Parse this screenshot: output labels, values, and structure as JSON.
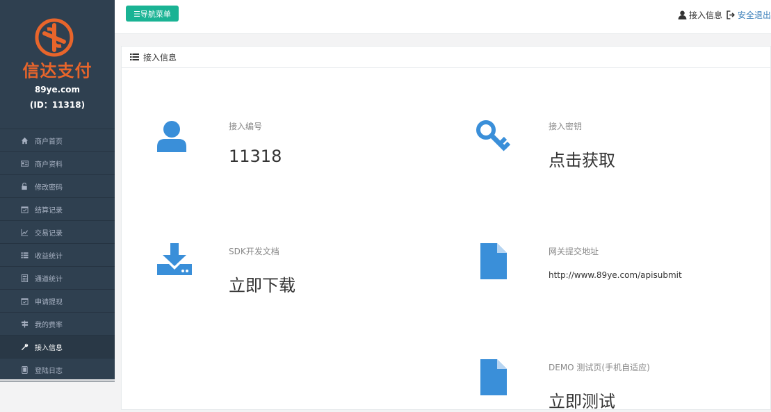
{
  "brand": {
    "logo_text": "信达支付",
    "domain": "89ye.com",
    "id_line": "(ID：11318)",
    "accent": "#e8652b"
  },
  "sidebar": {
    "items": [
      {
        "label": "商户首页",
        "icon": "home-icon"
      },
      {
        "label": "商户资料",
        "icon": "id-card-icon"
      },
      {
        "label": "修改密码",
        "icon": "unlock-icon"
      },
      {
        "label": "结算记录",
        "icon": "calendar-check-icon"
      },
      {
        "label": "交易记录",
        "icon": "line-chart-icon"
      },
      {
        "label": "收益统计",
        "icon": "list-icon"
      },
      {
        "label": "通道统计",
        "icon": "calculator-icon"
      },
      {
        "label": "申请提现",
        "icon": "calendar-check-icon"
      },
      {
        "label": "我的费率",
        "icon": "signpost-icon"
      },
      {
        "label": "接入信息",
        "icon": "wrench-icon",
        "active": true
      },
      {
        "label": "登陆日志",
        "icon": "tablet-icon"
      }
    ]
  },
  "topbar": {
    "nav_button": "☰导航菜单",
    "user_label": "接入信息",
    "logout_label": "安全退出"
  },
  "panel": {
    "title": "接入信息"
  },
  "cards": {
    "access_id": {
      "label": "接入编号",
      "value": "11318",
      "icon": "user-icon"
    },
    "access_key": {
      "label": "接入密钥",
      "value": "点击获取",
      "icon": "key-icon"
    },
    "sdk_docs": {
      "label": "SDK开发文档",
      "value": "立即下载",
      "icon": "download-icon"
    },
    "gateway": {
      "label": "网关提交地址",
      "value": "http://www.89ye.com/apisubmit",
      "icon": "file-icon"
    },
    "demo": {
      "label": "DEMO 测试页(手机自适应)",
      "value": "立即测试",
      "icon": "file-icon"
    }
  },
  "colors": {
    "sidebar_bg": "#2f4050",
    "primary_button": "#1ab394",
    "icon_blue": "#3a8fd9",
    "link_blue": "#337ab7"
  }
}
